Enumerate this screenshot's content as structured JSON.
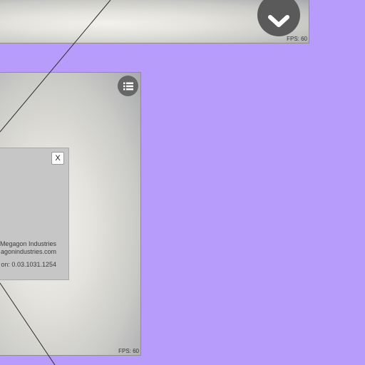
{
  "top_panel": {
    "fps": "FPS: 60",
    "expand_icon": "chevron-down-icon"
  },
  "main_panel": {
    "fps": "FPS: 60",
    "menu_icon": "list-icon",
    "about_dialog": {
      "close_label": "X",
      "company": "Megagon Industries",
      "website": "agonindustries.com",
      "version": "on: 0.03.1031.1254"
    }
  },
  "colors": {
    "background": "#b89cfb",
    "button": "#5a5a5a",
    "dialog": "#c6c6c6"
  }
}
